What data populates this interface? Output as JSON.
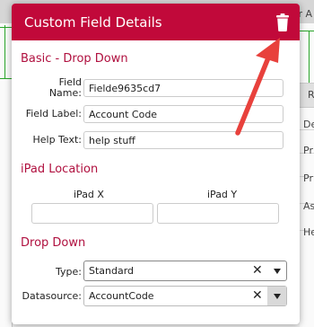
{
  "background": {
    "topbar_text": "r A",
    "table_header_letter": "R",
    "row_texts": [
      "De",
      "Pr",
      "Pr",
      "As",
      "He"
    ]
  },
  "modal": {
    "title": "Custom Field Details",
    "delete_icon": "trash-icon",
    "accent_color": "#c1093a",
    "basic_section": {
      "title": "Basic - Drop Down",
      "field_name_label": "Field Name:",
      "field_name_value": "Fielde9635cd7",
      "field_label_label": "Field Label:",
      "field_label_value": "Account Code",
      "help_text_label": "Help Text:",
      "help_text_value": "help stuff"
    },
    "ipad_section": {
      "title": "iPad Location",
      "x_label": "iPad X",
      "y_label": "iPad Y",
      "x_value": "",
      "y_value": ""
    },
    "dropdown_section": {
      "title": "Drop Down",
      "type_label": "Type:",
      "type_value": "Standard",
      "datasource_label": "Datasource:",
      "datasource_value": "AccountCode"
    }
  },
  "annotation": {
    "arrow_color": "#e8413c",
    "arrow_points_to": "trash-icon"
  }
}
